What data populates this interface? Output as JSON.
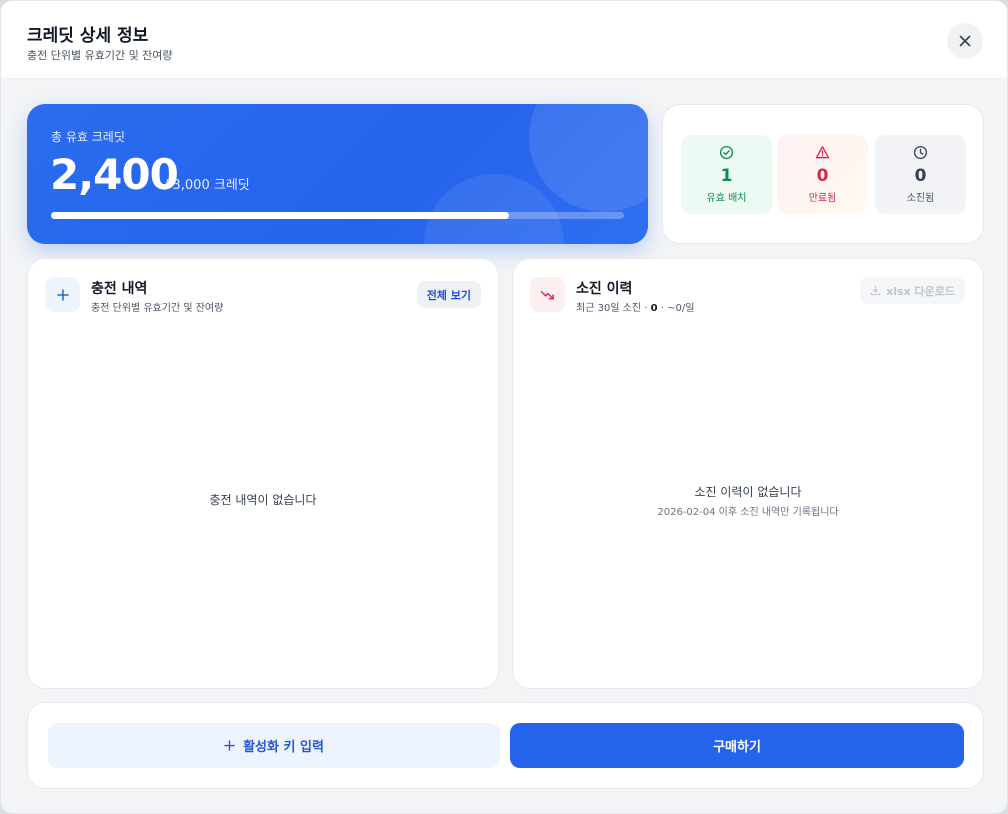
{
  "header": {
    "title": "크레딧 상세 정보",
    "subtitle": "충전 단위별 유효기간 및 잔여량"
  },
  "total": {
    "label": "총 유효 크레딧",
    "amount": "2,400",
    "of_total": "/ 3,000 크레딧",
    "progress": 0.8
  },
  "stats": {
    "valid": {
      "value": "1",
      "label": "유효 배치",
      "icon": "check-circle-icon"
    },
    "expired": {
      "value": "0",
      "label": "만료됨",
      "icon": "warning-triangle-icon"
    },
    "used": {
      "value": "0",
      "label": "소진됨",
      "icon": "clock-icon"
    }
  },
  "charge_panel": {
    "title": "충전 내역",
    "subtitle": "충전 단위별 유효기간 및 잔여량",
    "view_all": "전체 보기",
    "empty": "충전 내역이 없습니다"
  },
  "usage_panel": {
    "title": "소진 이력",
    "subtitle_prefix": "최근 30일 소진 ·",
    "recent_value": "0",
    "per_day": "· ~0/일",
    "download": "xlsx 다운로드",
    "empty": "소진 이력이 없습니다",
    "empty_note": "2026-02-04 이후 소진 내역만 기록됩니다"
  },
  "footer": {
    "activation_key": "활성화 키 입력",
    "purchase": "구매하기"
  },
  "colors": {
    "primary": "#2563eb",
    "valid": "#0f8a55",
    "expired": "#dc2646",
    "used": "#374151"
  }
}
